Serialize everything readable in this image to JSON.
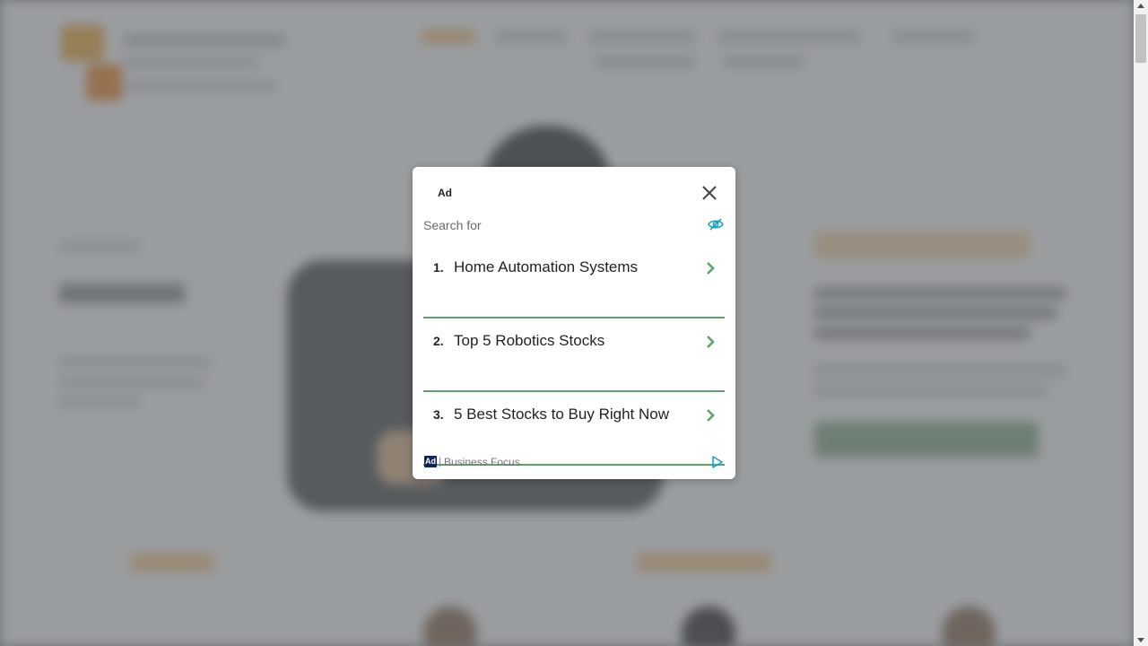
{
  "ad": {
    "label": "Ad",
    "search_prefix": "Search for",
    "items": [
      {
        "number": "1.",
        "label": "Home Automation Systems"
      },
      {
        "number": "2.",
        "label": "Top 5 Robotics Stocks"
      },
      {
        "number": "3.",
        "label": "5 Best Stocks to Buy Right Now"
      }
    ],
    "footer": {
      "badge": "Ad",
      "separator": "|",
      "brand": "Business Focus"
    }
  },
  "colors": {
    "divider": "#5aa46b",
    "chevron": "#5aa46b",
    "hide_icon": "#1aa3c9",
    "adchoices": "#1aa3c9",
    "badge": "#10245a"
  },
  "icons": [
    "close-icon",
    "hide-ad-icon",
    "chevron-right-icon",
    "adchoices-icon"
  ]
}
